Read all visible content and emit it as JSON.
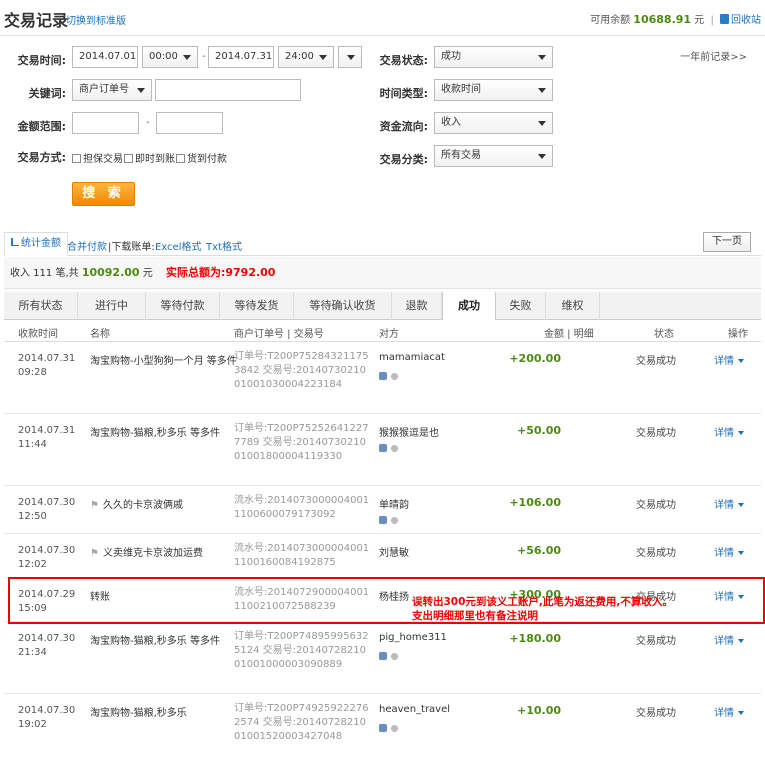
{
  "header": {
    "title": "交易记录",
    "switch_link": "切换到标准版",
    "balance_label": "可用余额",
    "balance_value": "10688.91",
    "balance_unit": "元",
    "recycle_link": "回收站"
  },
  "search": {
    "trade_time_label": "交易时间:",
    "start_date": "2014.07.01",
    "start_time": "00:00",
    "end_date": "2014.07.31",
    "end_time": "24:00",
    "keyword_label": "关键词:",
    "keyword_type": "商户订单号",
    "keyword_value": "",
    "amount_label": "金额范围:",
    "amount_from": "",
    "amount_to": "",
    "trade_method_label": "交易方式:",
    "methods": [
      "担保交易",
      "即时到账",
      "货到付款"
    ],
    "status_label": "交易状态:",
    "status_value": "成功",
    "time_type_label": "时间类型:",
    "time_type_value": "收款时间",
    "flow_label": "资金流向:",
    "flow_value": "收入",
    "category_label": "交易分类:",
    "category_value": "所有交易",
    "year_link": "一年前记录>>",
    "search_button": "搜 索"
  },
  "toolbar": {
    "stats_tab": "统计金额",
    "merge_pay": "合并付款",
    "download_label": "|下载账单:",
    "excel": "Excel格式",
    "txt": "Txt格式",
    "next_page": "下一页"
  },
  "summary": {
    "text_prefix": "收入 111 笔,共",
    "total": "10092.00",
    "unit": "元",
    "actual": "实际总额为:9792.00"
  },
  "status_tabs": [
    "所有状态",
    "进行中",
    "等待付款",
    "等待发货",
    "等待确认收货",
    "退款",
    "成功",
    "失败",
    "维权"
  ],
  "table_header": {
    "time": "收款时间",
    "name": "名称",
    "ids": "商户订单号 | 交易号",
    "party": "对方",
    "amount": "金额 | 明细",
    "status": "状态",
    "op": "操作"
  },
  "rows": [
    {
      "date": "2014.07.31",
      "time": "09:28",
      "name": "淘宝购物-小型狗狗一个月 等多件",
      "ids": "订单号:T200P752843211753842 交易号:2014073021001001030004223184",
      "party": "mamamiacat",
      "amount": "+200.00",
      "status": "交易成功",
      "op": "详情"
    },
    {
      "date": "2014.07.31",
      "time": "11:44",
      "name": "淘宝购物-猫粮,秒多乐 等多件",
      "ids": "订单号:T200P752526412277789 交易号:2014073021001001800004119330",
      "party": "猴猴猴逗是也",
      "amount": "+50.00",
      "status": "交易成功",
      "op": "详情"
    },
    {
      "date": "2014.07.30",
      "time": "12:50",
      "name": "久久的卡京波俩戚",
      "ids": "流水号:20140730000040011100600079173092",
      "party": "单晴韵",
      "amount": "+106.00",
      "status": "交易成功",
      "op": "详情"
    },
    {
      "date": "2014.07.30",
      "time": "12:02",
      "name": "义卖维克卡京波加运费",
      "ids": "流水号:20140730000040011100160084192875",
      "party": "刘慧敏",
      "amount": "+56.00",
      "status": "交易成功",
      "op": "详情"
    },
    {
      "date": "2014.07.29",
      "time": "15:09",
      "name": "转账",
      "ids": "流水号:20140729000040011100210072588239",
      "party": "杨桂扬",
      "amount": "+300.00",
      "status": "交易成功",
      "op": "详情"
    },
    {
      "date": "2014.07.30",
      "time": "21:34",
      "name": "淘宝购物-猫粮,秒多乐 等多件",
      "ids": "订单号:T200P748959956325124 交易号:2014072821001001000003090889",
      "party": "pig_home311",
      "amount": "+180.00",
      "status": "交易成功",
      "op": "详情"
    },
    {
      "date": "2014.07.30",
      "time": "19:02",
      "name": "淘宝购物-猫粮,秒多乐",
      "ids": "订单号:T200P749259222762574 交易号:2014072821001001520003427048",
      "party": "heaven_travel",
      "amount": "+10.00",
      "status": "交易成功",
      "op": "详情"
    }
  ],
  "annotation": {
    "line1": "误转出300元到该义工账户,此笔为返还费用,不算收入。",
    "line2": "支出明细那里也有备注说明"
  }
}
